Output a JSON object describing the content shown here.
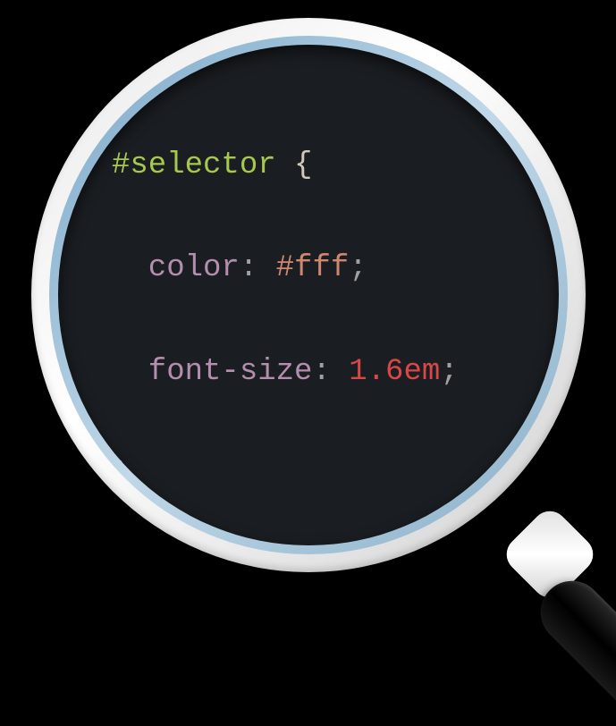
{
  "code": {
    "selector": "#selector",
    "brace_open": "{",
    "brace_close": "}",
    "props": [
      {
        "name": "color",
        "value": "#fff"
      },
      {
        "name": "font-size",
        "value": "1.6em"
      }
    ],
    "colon": ":",
    "semicolon": ";"
  }
}
